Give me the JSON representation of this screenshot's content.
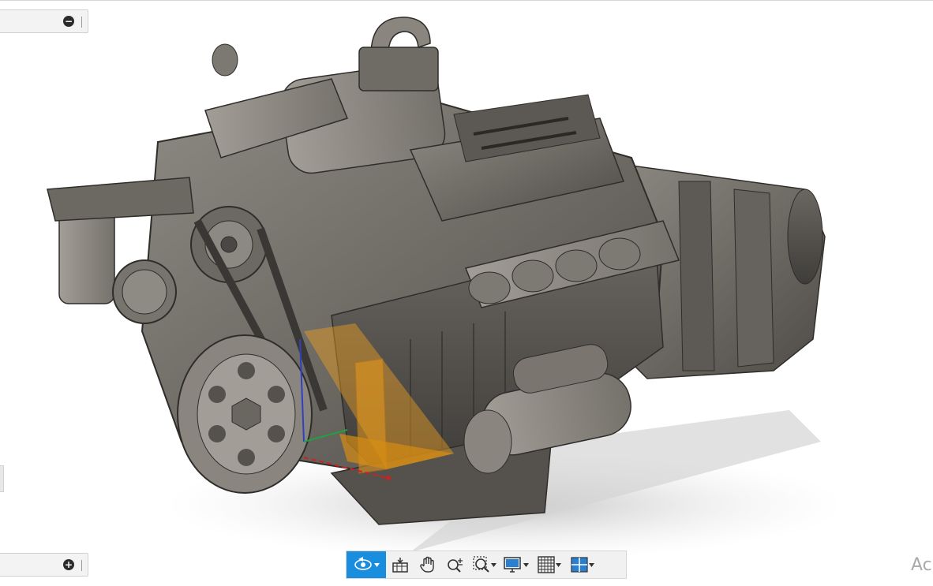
{
  "viewport": {
    "model": "v8-diesel-engine-assembly",
    "background": "#ffffff",
    "body_color": "#6e6a64",
    "highlight_color": "#f0a020"
  },
  "browser_panel": {
    "collapse_icon": "minus-circle-icon"
  },
  "comments_panel": {
    "expand_icon": "plus-circle-icon"
  },
  "nav_toolbar": {
    "accent": "#1a8ede",
    "tools": [
      {
        "name": "orbit",
        "icon": "orbit-icon",
        "has_menu": true,
        "active": true
      },
      {
        "name": "look-at",
        "icon": "look-at-icon",
        "has_menu": false,
        "active": false
      },
      {
        "name": "pan",
        "icon": "pan-hand-icon",
        "has_menu": false,
        "active": false
      },
      {
        "name": "zoom",
        "icon": "zoom-icon",
        "has_menu": false,
        "active": false
      },
      {
        "name": "fit",
        "icon": "zoom-window-icon",
        "has_menu": true,
        "active": false
      },
      {
        "name": "display-settings",
        "icon": "monitor-icon",
        "has_menu": true,
        "active": false
      },
      {
        "name": "grid-and-snaps",
        "icon": "grid-icon",
        "has_menu": true,
        "active": false
      },
      {
        "name": "viewports",
        "icon": "viewports-icon",
        "has_menu": true,
        "active": false
      }
    ]
  },
  "watermark": {
    "text": "Ac"
  }
}
